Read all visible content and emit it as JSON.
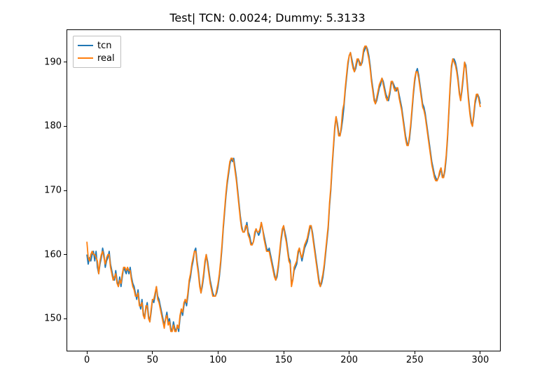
{
  "chart_data": {
    "type": "line",
    "title": "Test| TCN: 0.0024; Dummy: 5.3133",
    "xlabel": "",
    "ylabel": "",
    "xlim": [
      -15,
      315
    ],
    "ylim": [
      145,
      195
    ],
    "xticks": [
      0,
      50,
      100,
      150,
      200,
      250,
      300
    ],
    "yticks": [
      150,
      160,
      170,
      180,
      190
    ],
    "legend_position": "upper left",
    "x": [
      0,
      1,
      2,
      3,
      4,
      5,
      6,
      7,
      8,
      9,
      10,
      11,
      12,
      13,
      14,
      15,
      16,
      17,
      18,
      19,
      20,
      21,
      22,
      23,
      24,
      25,
      26,
      27,
      28,
      29,
      30,
      31,
      32,
      33,
      34,
      35,
      36,
      37,
      38,
      39,
      40,
      41,
      42,
      43,
      44,
      45,
      46,
      47,
      48,
      49,
      50,
      51,
      52,
      53,
      54,
      55,
      56,
      57,
      58,
      59,
      60,
      61,
      62,
      63,
      64,
      65,
      66,
      67,
      68,
      69,
      70,
      71,
      72,
      73,
      74,
      75,
      76,
      77,
      78,
      79,
      80,
      81,
      82,
      83,
      84,
      85,
      86,
      87,
      88,
      89,
      90,
      91,
      92,
      93,
      94,
      95,
      96,
      97,
      98,
      99,
      100,
      101,
      102,
      103,
      104,
      105,
      106,
      107,
      108,
      109,
      110,
      111,
      112,
      113,
      114,
      115,
      116,
      117,
      118,
      119,
      120,
      121,
      122,
      123,
      124,
      125,
      126,
      127,
      128,
      129,
      130,
      131,
      132,
      133,
      134,
      135,
      136,
      137,
      138,
      139,
      140,
      141,
      142,
      143,
      144,
      145,
      146,
      147,
      148,
      149,
      150,
      151,
      152,
      153,
      154,
      155,
      156,
      157,
      158,
      159,
      160,
      161,
      162,
      163,
      164,
      165,
      166,
      167,
      168,
      169,
      170,
      171,
      172,
      173,
      174,
      175,
      176,
      177,
      178,
      179,
      180,
      181,
      182,
      183,
      184,
      185,
      186,
      187,
      188,
      189,
      190,
      191,
      192,
      193,
      194,
      195,
      196,
      197,
      198,
      199,
      200,
      201,
      202,
      203,
      204,
      205,
      206,
      207,
      208,
      209,
      210,
      211,
      212,
      213,
      214,
      215,
      216,
      217,
      218,
      219,
      220,
      221,
      222,
      223,
      224,
      225,
      226,
      227,
      228,
      229,
      230,
      231,
      232,
      233,
      234,
      235,
      236,
      237,
      238,
      239,
      240,
      241,
      242,
      243,
      244,
      245,
      246,
      247,
      248,
      249,
      250,
      251,
      252,
      253,
      254,
      255,
      256,
      257,
      258,
      259,
      260,
      261,
      262,
      263,
      264,
      265,
      266,
      267,
      268,
      269,
      270,
      271,
      272,
      273,
      274,
      275,
      276,
      277,
      278,
      279,
      280,
      281,
      282,
      283,
      284,
      285,
      286,
      287,
      288,
      289,
      290,
      291,
      292,
      293,
      294,
      295,
      296,
      297,
      298,
      299,
      300
    ],
    "series": [
      {
        "name": "tcn",
        "color": "#1f77b4",
        "values": [
          160.0,
          158.5,
          159.5,
          159.0,
          160.0,
          160.5,
          159.0,
          160.5,
          158.0,
          157.0,
          158.5,
          159.5,
          161.0,
          160.0,
          158.0,
          159.0,
          159.5,
          160.5,
          158.5,
          157.5,
          156.5,
          156.0,
          157.5,
          156.0,
          155.0,
          156.5,
          155.0,
          156.5,
          158.0,
          157.5,
          157.0,
          158.0,
          157.0,
          158.0,
          156.5,
          155.5,
          155.0,
          154.0,
          153.0,
          154.5,
          152.5,
          151.5,
          153.0,
          151.0,
          150.0,
          151.5,
          152.5,
          150.5,
          149.5,
          151.0,
          153.0,
          152.5,
          153.5,
          155.0,
          153.5,
          153.0,
          152.0,
          151.0,
          150.0,
          149.0,
          150.0,
          151.0,
          149.5,
          150.0,
          148.5,
          148.0,
          149.5,
          148.5,
          148.0,
          149.0,
          148.0,
          150.0,
          151.5,
          150.5,
          152.0,
          153.0,
          152.0,
          153.5,
          155.5,
          156.5,
          158.0,
          159.0,
          160.5,
          161.0,
          159.0,
          157.5,
          155.5,
          154.0,
          155.0,
          156.5,
          158.5,
          160.0,
          159.0,
          157.5,
          156.0,
          155.0,
          154.0,
          153.5,
          153.5,
          154.0,
          155.0,
          156.5,
          158.5,
          161.0,
          164.0,
          166.5,
          169.0,
          171.0,
          172.5,
          174.0,
          175.0,
          174.5,
          175.0,
          173.5,
          172.0,
          170.0,
          168.0,
          166.0,
          164.5,
          163.5,
          163.5,
          164.0,
          165.0,
          163.5,
          163.0,
          162.0,
          161.5,
          162.0,
          163.0,
          164.0,
          163.5,
          163.0,
          163.5,
          165.0,
          164.0,
          163.0,
          162.0,
          161.0,
          160.5,
          161.0,
          160.0,
          159.0,
          158.0,
          157.0,
          156.0,
          156.5,
          158.0,
          160.0,
          162.0,
          163.5,
          164.5,
          163.5,
          162.5,
          161.0,
          159.5,
          159.0,
          155.5,
          156.0,
          157.5,
          158.0,
          158.5,
          160.0,
          161.0,
          160.0,
          159.0,
          160.0,
          161.0,
          161.5,
          162.0,
          163.0,
          164.0,
          164.5,
          163.5,
          162.0,
          160.5,
          159.0,
          157.5,
          156.0,
          155.0,
          155.5,
          156.5,
          158.0,
          160.0,
          162.0,
          164.0,
          167.5,
          170.0,
          173.5,
          176.5,
          179.5,
          181.5,
          180.5,
          179.0,
          178.5,
          179.5,
          181.0,
          183.0,
          185.5,
          187.5,
          189.5,
          191.0,
          191.5,
          190.5,
          189.5,
          188.5,
          189.0,
          190.0,
          190.5,
          190.0,
          189.5,
          190.0,
          191.5,
          192.0,
          192.5,
          192.0,
          191.0,
          189.5,
          187.5,
          186.0,
          184.5,
          183.5,
          184.0,
          185.0,
          186.0,
          186.5,
          187.5,
          187.0,
          186.0,
          185.0,
          184.5,
          184.0,
          185.0,
          186.5,
          187.0,
          186.5,
          186.0,
          185.5,
          186.0,
          185.0,
          184.0,
          183.0,
          181.5,
          180.0,
          178.5,
          177.5,
          177.0,
          178.0,
          180.0,
          182.5,
          185.0,
          187.0,
          188.5,
          189.0,
          188.0,
          186.5,
          185.0,
          183.5,
          183.0,
          182.0,
          180.5,
          179.0,
          177.5,
          176.0,
          174.5,
          173.5,
          172.5,
          172.0,
          171.5,
          172.0,
          172.5,
          173.5,
          172.5,
          172.0,
          173.0,
          175.0,
          178.0,
          182.0,
          186.0,
          189.0,
          190.5,
          190.5,
          190.0,
          189.0,
          187.5,
          185.5,
          184.0,
          185.5,
          187.5,
          190.0,
          189.5,
          187.0,
          184.5,
          182.5,
          181.0,
          180.0,
          181.5,
          183.5,
          184.5,
          185.0,
          184.5,
          183.5
        ]
      },
      {
        "name": "real",
        "color": "#ff7f0e",
        "values": [
          162.0,
          159.5,
          159.0,
          160.0,
          160.5,
          160.0,
          160.0,
          159.5,
          159.0,
          157.0,
          159.0,
          160.0,
          160.5,
          159.5,
          158.5,
          159.5,
          160.0,
          160.0,
          158.0,
          157.0,
          156.0,
          156.5,
          157.0,
          155.5,
          155.0,
          156.0,
          155.5,
          157.0,
          158.0,
          158.0,
          157.5,
          158.0,
          157.5,
          157.5,
          156.0,
          155.0,
          154.5,
          153.5,
          153.5,
          154.0,
          152.0,
          152.0,
          152.5,
          150.5,
          150.0,
          152.0,
          152.0,
          150.0,
          149.5,
          151.5,
          153.0,
          153.0,
          154.0,
          155.0,
          153.0,
          152.5,
          151.5,
          150.5,
          149.5,
          148.5,
          150.0,
          150.5,
          149.0,
          149.5,
          148.0,
          148.0,
          149.0,
          148.0,
          148.0,
          149.0,
          148.5,
          150.5,
          151.5,
          151.0,
          152.5,
          153.0,
          152.5,
          154.0,
          156.0,
          157.0,
          158.5,
          159.5,
          160.5,
          160.5,
          158.5,
          157.0,
          155.0,
          154.0,
          155.5,
          157.0,
          159.0,
          160.0,
          158.5,
          157.0,
          155.5,
          154.5,
          153.5,
          153.5,
          153.5,
          154.5,
          155.5,
          157.0,
          159.0,
          161.5,
          164.5,
          167.0,
          169.5,
          171.5,
          173.0,
          174.5,
          175.0,
          175.0,
          174.5,
          173.0,
          171.5,
          169.5,
          167.5,
          165.5,
          164.0,
          163.5,
          163.5,
          164.5,
          164.5,
          163.0,
          162.5,
          161.5,
          161.5,
          162.0,
          163.5,
          164.0,
          163.5,
          163.5,
          164.0,
          165.0,
          164.0,
          162.5,
          161.5,
          160.5,
          160.5,
          160.5,
          159.5,
          158.5,
          157.5,
          156.5,
          156.0,
          157.0,
          158.5,
          160.5,
          162.5,
          164.0,
          164.5,
          163.0,
          162.0,
          160.5,
          159.0,
          158.5,
          155.0,
          156.0,
          158.0,
          158.5,
          159.0,
          160.5,
          161.0,
          160.0,
          159.5,
          160.5,
          161.5,
          162.0,
          162.5,
          163.5,
          164.5,
          164.5,
          163.0,
          161.5,
          160.0,
          158.5,
          157.0,
          155.5,
          155.0,
          156.0,
          157.0,
          158.5,
          160.5,
          162.5,
          164.5,
          168.0,
          170.5,
          174.0,
          177.0,
          180.0,
          181.5,
          180.0,
          178.5,
          178.5,
          180.0,
          182.5,
          183.5,
          186.0,
          188.0,
          190.0,
          191.0,
          191.5,
          190.0,
          189.0,
          188.5,
          189.5,
          190.5,
          190.5,
          189.5,
          189.5,
          190.5,
          192.0,
          192.5,
          192.5,
          191.5,
          190.5,
          189.0,
          187.0,
          185.5,
          184.0,
          183.5,
          184.5,
          185.5,
          186.5,
          187.0,
          187.5,
          186.5,
          185.5,
          184.5,
          184.0,
          184.5,
          185.5,
          187.0,
          187.0,
          186.0,
          185.5,
          186.0,
          186.0,
          184.5,
          183.5,
          182.5,
          181.0,
          179.5,
          178.0,
          177.0,
          177.0,
          178.5,
          180.5,
          183.0,
          185.5,
          187.5,
          188.5,
          188.5,
          187.5,
          186.0,
          184.5,
          183.0,
          182.5,
          181.5,
          180.0,
          178.5,
          177.0,
          175.5,
          174.0,
          173.0,
          172.0,
          171.5,
          171.5,
          172.0,
          173.0,
          173.5,
          172.0,
          172.0,
          173.5,
          175.5,
          178.5,
          182.5,
          186.5,
          189.5,
          190.5,
          190.0,
          189.5,
          188.5,
          187.0,
          185.0,
          184.0,
          186.0,
          188.0,
          190.0,
          189.0,
          186.5,
          184.0,
          182.0,
          180.5,
          180.0,
          182.0,
          184.0,
          185.0,
          185.0,
          184.0,
          183.0
        ]
      }
    ]
  }
}
